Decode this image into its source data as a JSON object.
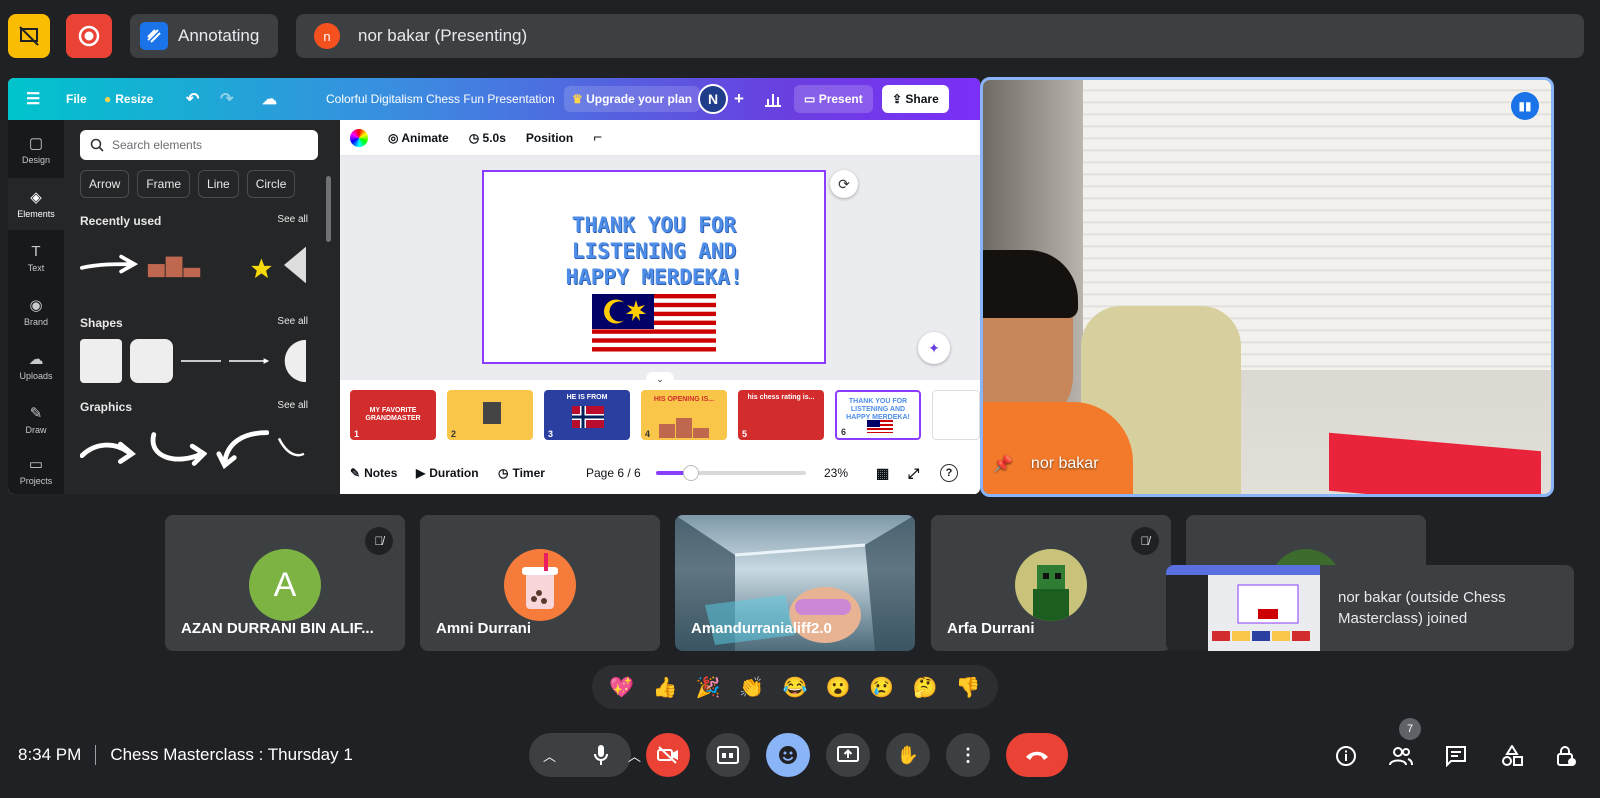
{
  "topbar": {
    "annotating_label": "Annotating",
    "presenter_initial": "n",
    "presenting_label": "nor bakar (Presenting)"
  },
  "canva": {
    "menu": {
      "file": "File",
      "resize": "Resize"
    },
    "doc_title": "Colorful Digitalism Chess Fun Presentation",
    "upgrade": "Upgrade your plan",
    "user_initial": "N",
    "present": "Present",
    "share": "Share",
    "rail": [
      {
        "label": "Design",
        "icon": "▢"
      },
      {
        "label": "Elements",
        "icon": "◈"
      },
      {
        "label": "Text",
        "icon": "T"
      },
      {
        "label": "Brand",
        "icon": "◉"
      },
      {
        "label": "Uploads",
        "icon": "☁"
      },
      {
        "label": "Draw",
        "icon": "✎"
      },
      {
        "label": "Projects",
        "icon": "▭"
      }
    ],
    "search_placeholder": "Search elements",
    "chips": [
      "Arrow",
      "Frame",
      "Line",
      "Circle"
    ],
    "sections": {
      "recent": "Recently used",
      "shapes": "Shapes",
      "graphics": "Graphics",
      "see_all": "See all"
    },
    "toolbar": {
      "animate": "Animate",
      "duration": "5.0s",
      "position": "Position"
    },
    "slide_title": "THANK YOU FOR\nLISTENING AND\nHAPPY MERDEKA!",
    "thumbnails": [
      {
        "num": "1",
        "text": "MY FAVORITE GRANDMASTER",
        "bg": "#d22c2c"
      },
      {
        "num": "2",
        "text": "",
        "bg": "#f9c64a"
      },
      {
        "num": "3",
        "text": "HE IS FROM",
        "bg": "#2a3fa0"
      },
      {
        "num": "4",
        "text": "HIS OPENING IS...",
        "bg": "#f9c64a"
      },
      {
        "num": "5",
        "text": "his chess rating is...",
        "bg": "#d22c2c"
      },
      {
        "num": "6",
        "text": "THANK YOU FOR LISTENING AND HAPPY MERDEKA!",
        "bg": "#ffffff"
      }
    ],
    "footer": {
      "notes": "Notes",
      "duration": "Duration",
      "timer": "Timer",
      "page": "Page 6 / 6",
      "zoom": "23%",
      "zoom_fraction": 0.23
    }
  },
  "presenter": {
    "name": "nor bakar"
  },
  "participants": [
    {
      "name": "AZAN DURRANI BIN ALIF...",
      "initial": "A",
      "color": "#7cb342",
      "muted": true
    },
    {
      "name": "Amni Durrani",
      "initial": "",
      "color": "#f57c3a",
      "muted": false
    },
    {
      "name": "Amandurranialiff2.0",
      "initial": "",
      "color": "#5b7a8c",
      "muted": false
    },
    {
      "name": "Arfa Durrani",
      "initial": "",
      "color": "#3d6b2e",
      "muted": true
    }
  ],
  "toast": {
    "text": "nor bakar (outside Chess Masterclass) joined"
  },
  "reactions": [
    "💖",
    "👍",
    "🎉",
    "👏",
    "😂",
    "😮",
    "😢",
    "🤔",
    "👎"
  ],
  "bottom": {
    "time": "8:34 PM",
    "meeting": "Chess Masterclass : Thursday 1",
    "people_count": "7"
  }
}
